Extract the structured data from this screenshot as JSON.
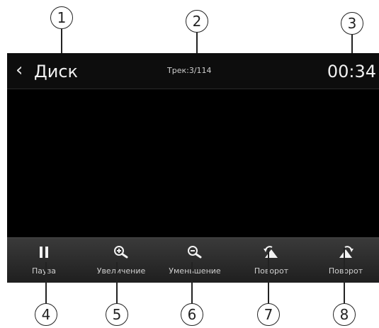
{
  "header": {
    "back_icon": "chevron-left-icon",
    "title": "Диск",
    "track": "Трек:3/114",
    "time": "00:34"
  },
  "toolbar": {
    "items": [
      {
        "label": "Пауза",
        "icon": "pause-icon"
      },
      {
        "label": "Увеличение",
        "icon": "zoom-in-icon"
      },
      {
        "label": "Уменьшение",
        "icon": "zoom-out-icon"
      },
      {
        "label": "Поворот",
        "icon": "rotate-left-icon"
      },
      {
        "label": "Поворот",
        "icon": "rotate-right-icon"
      }
    ]
  },
  "callouts": [
    "1",
    "2",
    "3",
    "4",
    "5",
    "6",
    "7",
    "8"
  ],
  "colors": {
    "screen": "#000000",
    "toolbar": "#2e2e2e",
    "text": "#f0f0f0"
  }
}
